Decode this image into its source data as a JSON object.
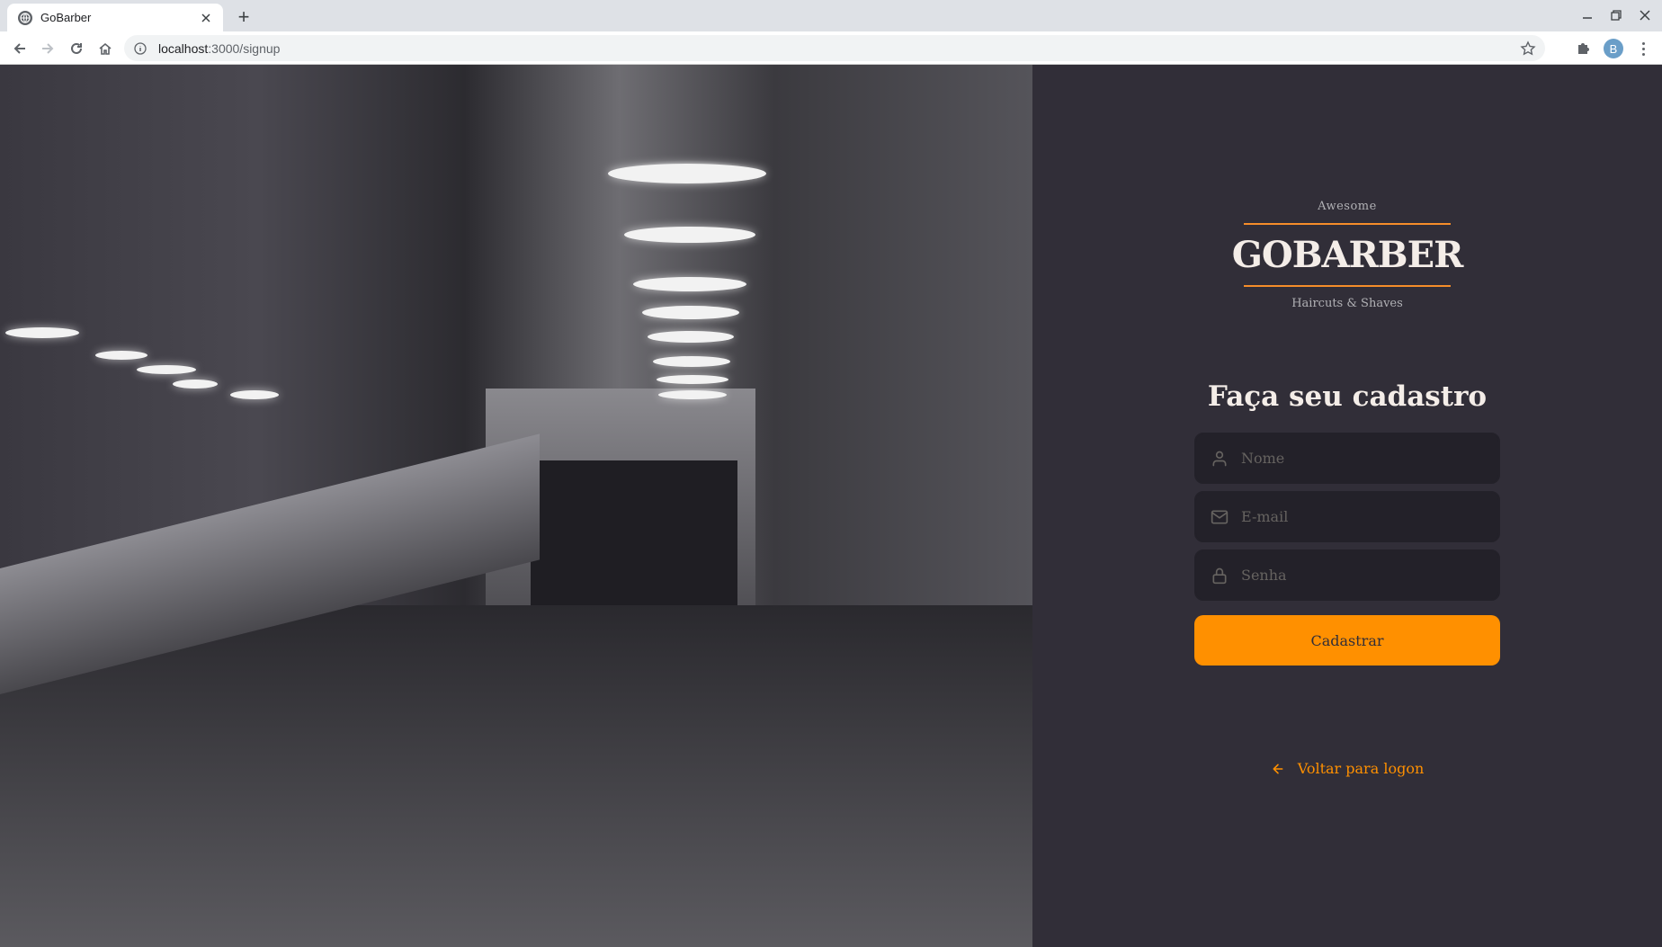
{
  "browser": {
    "tab_title": "GoBarber",
    "new_tab_symbol": "+",
    "url_host": "localhost",
    "url_path": ":3000/signup",
    "profile_initial": "B",
    "icons": [
      "globe-icon",
      "close-icon",
      "back-arrow-icon",
      "forward-arrow-icon",
      "reload-icon",
      "home-icon",
      "info-icon",
      "star-icon",
      "puzzle-icon",
      "menu-dots-icon"
    ]
  },
  "logo": {
    "top": "Awesome",
    "main": "GOBARBER",
    "bottom": "Haircuts & Shaves"
  },
  "signup": {
    "title": "Faça seu cadastro",
    "name_placeholder": "Nome",
    "email_placeholder": "E-mail",
    "password_placeholder": "Senha",
    "submit_label": "Cadastrar",
    "back_label": "Voltar para logon"
  },
  "colors": {
    "background": "#312e38",
    "input_background": "#232129",
    "accent": "#ff9000",
    "text": "#f4ede8",
    "placeholder": "#666360"
  }
}
